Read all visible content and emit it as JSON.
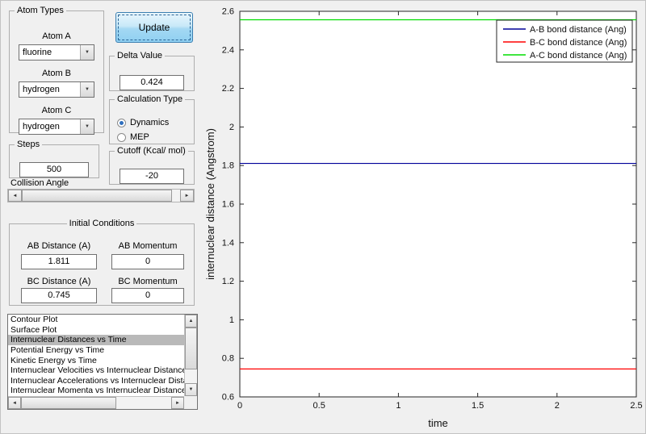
{
  "ui": {
    "background": "#f0f0f0",
    "update_button_accent": "#9ed7f3",
    "list_selection_gray": "#b9b9b9"
  },
  "icons": {
    "dropdown_arrow": "▼",
    "scroll_left": "◄",
    "scroll_right": "►",
    "scroll_up": "▲",
    "scroll_down": "▼"
  },
  "atom_types": {
    "legend": "Atom Types",
    "atom_a_label": "Atom A",
    "atom_a_value": "fluorine",
    "atom_b_label": "Atom B",
    "atom_b_value": "hydrogen",
    "atom_c_label": "Atom C",
    "atom_c_value": "hydrogen"
  },
  "update_button_label": "Update",
  "delta": {
    "legend": "Delta Value",
    "value": "0.424"
  },
  "calculation": {
    "legend": "Calculation Type",
    "options": [
      {
        "label": "Dynamics",
        "selected": true
      },
      {
        "label": "MEP",
        "selected": false
      }
    ]
  },
  "steps": {
    "legend": "Steps",
    "value": "500"
  },
  "cutoff": {
    "legend": "Cutoff (Kcal/ mol)",
    "value": "-20"
  },
  "collision_angle": {
    "label": "Collision Angle"
  },
  "initial_conditions": {
    "legend": "Initial Conditions",
    "ab_distance_label": "AB Distance (A)",
    "ab_distance_value": "1.811",
    "ab_momentum_label": "AB Momentum",
    "ab_momentum_value": "0",
    "bc_distance_label": "BC Distance (A)",
    "bc_distance_value": "0.745",
    "bc_momentum_label": "BC Momentum",
    "bc_momentum_value": "0"
  },
  "plot_list": {
    "items": [
      "Contour Plot",
      "Surface Plot",
      "Internuclear Distances vs Time",
      "Potential Energy vs Time",
      "Kinetic Energy vs Time",
      "Internuclear Velocities vs Internuclear Distance",
      "Internuclear Accelerations vs Internuclear Distance",
      "Internuclear Momenta vs Internuclear Distance"
    ],
    "selected_index": 2
  },
  "chart_data": {
    "type": "line",
    "title": "",
    "xlabel": "time",
    "ylabel": "internuclear distance (Angstrom)",
    "xlim": [
      0,
      2.5
    ],
    "ylim": [
      0.6,
      2.6
    ],
    "xticks": [
      0,
      0.5,
      1,
      1.5,
      2,
      2.5
    ],
    "yticks": [
      0.6,
      0.8,
      1,
      1.2,
      1.4,
      1.6,
      1.8,
      2,
      2.2,
      2.4,
      2.6
    ],
    "x": [
      0,
      2.5
    ],
    "series": [
      {
        "name": "A-B bond distance (Ang)",
        "color": "#000099",
        "values": [
          1.811,
          1.811
        ]
      },
      {
        "name": "B-C bond distance (Ang)",
        "color": "#ff0000",
        "values": [
          0.745,
          0.745
        ]
      },
      {
        "name": "A-C bond distance (Ang)",
        "color": "#00dd00",
        "values": [
          2.556,
          2.556
        ]
      }
    ],
    "legend_position": "top-right",
    "grid": false
  }
}
